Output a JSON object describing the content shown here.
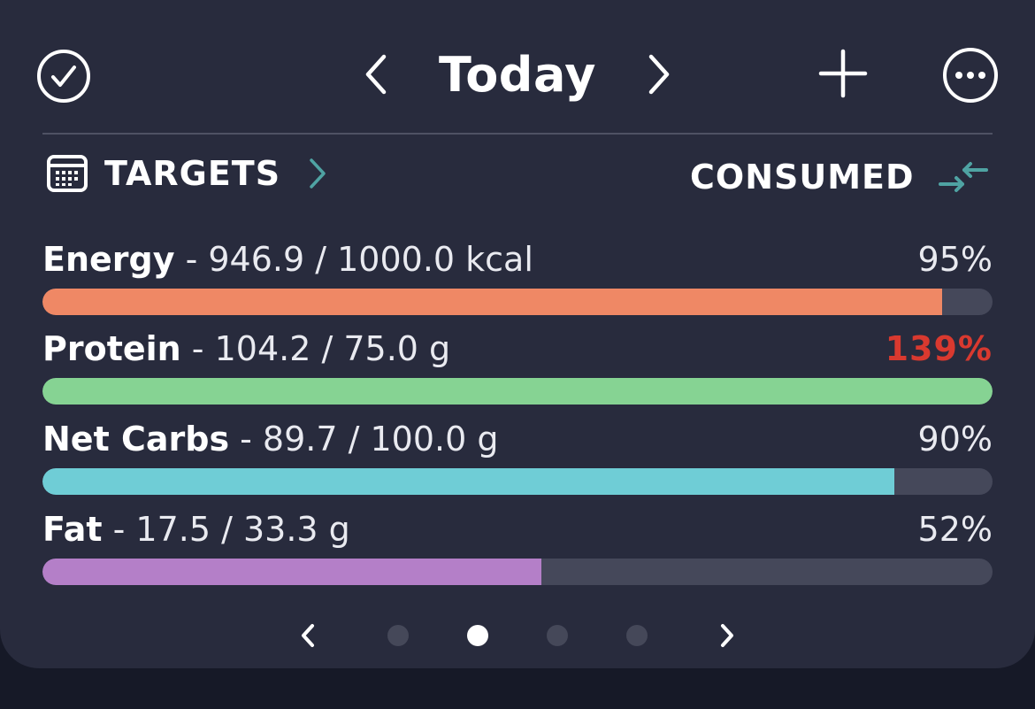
{
  "header": {
    "title": "Today",
    "icons": {
      "complete": "check-circle-icon",
      "prev_day": "chevron-left-icon",
      "next_day": "chevron-right-icon",
      "add": "plus-icon",
      "more": "more-horizontal-icon"
    }
  },
  "targets": {
    "label": "TARGETS",
    "icon": "calendar-icon",
    "arrow_icon": "chevron-right-icon",
    "mode_label": "CONSUMED",
    "mode_icon": "swap-arrows-icon"
  },
  "nutrients": [
    {
      "name": "Energy",
      "detail": " - 946.9 / 1000.0 kcal",
      "percent": "95%",
      "fill": 0.947,
      "color": "#ef8865",
      "over": false
    },
    {
      "name": "Protein",
      "detail": " - 104.2 / 75.0 g",
      "percent": "139%",
      "fill": 1.0,
      "color": "#86d393",
      "over": true
    },
    {
      "name": "Net Carbs",
      "detail": " - 89.7 / 100.0 g",
      "percent": "90%",
      "fill": 0.897,
      "color": "#6fcdd6",
      "over": false
    },
    {
      "name": "Fat",
      "detail": " - 17.5 / 33.3 g",
      "percent": "52%",
      "fill": 0.525,
      "color": "#b47fc8",
      "over": false
    }
  ],
  "pager": {
    "pages": 4,
    "active_index": 1,
    "prev_icon": "chevron-left-icon",
    "next_icon": "chevron-right-icon"
  },
  "colors": {
    "background": "#282b3d",
    "track": "#45485a",
    "accent": "#4fa3a3",
    "over_target": "#d9392f"
  }
}
